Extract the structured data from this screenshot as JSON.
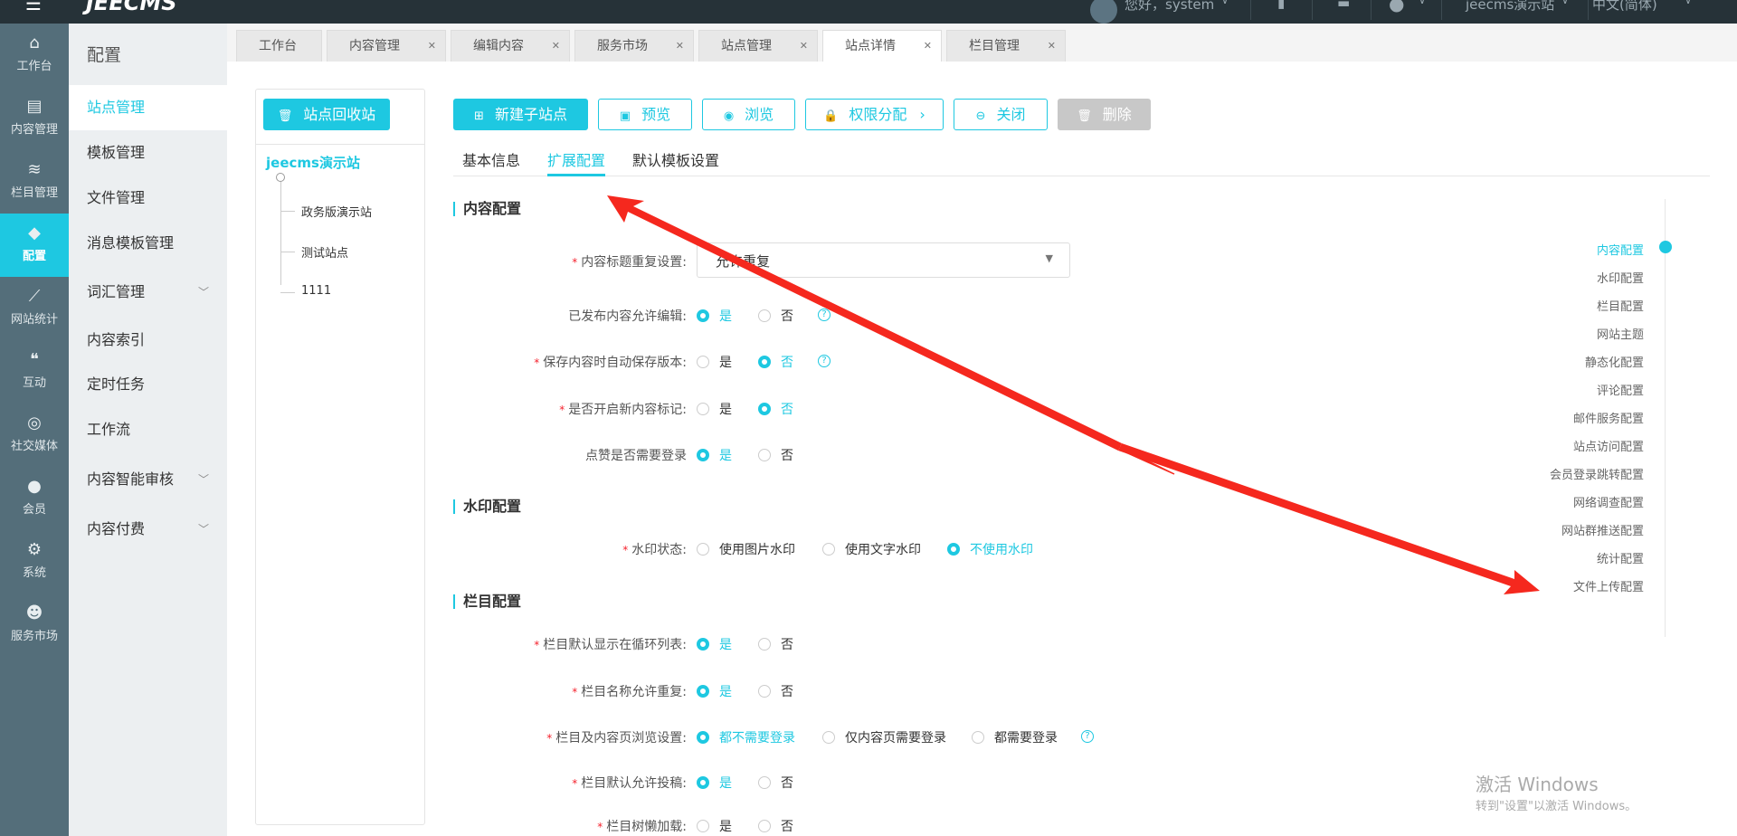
{
  "header": {
    "logo": "JEECMS",
    "greeting": "您好，system",
    "site": "jeecms演示站",
    "language": "中文(简体)"
  },
  "rail": [
    {
      "label": "工作台",
      "icon": "home-icon"
    },
    {
      "label": "内容管理",
      "icon": "document-edit-icon"
    },
    {
      "label": "栏目管理",
      "icon": "layers-icon"
    },
    {
      "label": "配置",
      "icon": "cube-icon",
      "active": true
    },
    {
      "label": "网站统计",
      "icon": "line-chart-icon"
    },
    {
      "label": "互动",
      "icon": "chat-icon"
    },
    {
      "label": "社交媒体",
      "icon": "target-icon"
    },
    {
      "label": "会员",
      "icon": "user-check-icon"
    },
    {
      "label": "系统",
      "icon": "gear-icon"
    },
    {
      "label": "服务市场",
      "icon": "headset-icon"
    }
  ],
  "submenu": {
    "title": "配置",
    "items": [
      {
        "label": "站点管理",
        "active": true
      },
      {
        "label": "模板管理"
      },
      {
        "label": "文件管理"
      },
      {
        "label": "消息模板管理"
      },
      {
        "label": "词汇管理",
        "expandable": true
      },
      {
        "label": "内容索引"
      },
      {
        "label": "定时任务"
      },
      {
        "label": "工作流"
      },
      {
        "label": "内容智能审核",
        "expandable": true
      },
      {
        "label": "内容付费",
        "expandable": true
      }
    ]
  },
  "tabs": [
    {
      "label": "工作台"
    },
    {
      "label": "内容管理",
      "closable": true
    },
    {
      "label": "编辑内容",
      "closable": true
    },
    {
      "label": "服务市场",
      "closable": true
    },
    {
      "label": "站点管理",
      "closable": true
    },
    {
      "label": "站点详情",
      "closable": true,
      "active": true
    },
    {
      "label": "栏目管理",
      "closable": true
    }
  ],
  "tree": {
    "recycle_button": "站点回收站",
    "root": "jeecms演示站",
    "children": [
      "政务版演示站",
      "测试站点",
      "1111"
    ]
  },
  "actions": [
    {
      "label": "新建子站点",
      "icon": "add-site-icon"
    },
    {
      "label": "预览",
      "icon": "preview-icon"
    },
    {
      "label": "浏览",
      "icon": "eye-icon"
    },
    {
      "label": "权限分配",
      "icon": "lock-icon"
    },
    {
      "label": "关闭",
      "icon": "minus-circle-icon"
    },
    {
      "label": "删除",
      "icon": "trash-icon"
    }
  ],
  "subtabs": [
    "基本信息",
    "扩展配置",
    "默认模板设置"
  ],
  "sections": {
    "content": "内容配置",
    "watermark": "水印配置",
    "column": "栏目配置"
  },
  "form": {
    "title_repeat": {
      "label": "内容标题重复设置:",
      "value": "允许重复"
    },
    "published_edit": {
      "label": "已发布内容允许编辑:",
      "options": [
        "是",
        "否"
      ],
      "selected": 0
    },
    "auto_save": {
      "label": "保存内容时自动保存版本:",
      "options": [
        "是",
        "否"
      ],
      "selected": 1
    },
    "new_mark": {
      "label": "是否开启新内容标记:",
      "options": [
        "是",
        "否"
      ],
      "selected": 1
    },
    "like_login": {
      "label": "点赞是否需要登录",
      "options": [
        "是",
        "否"
      ],
      "selected": 0
    },
    "watermark_status": {
      "label": "水印状态:",
      "options": [
        "使用图片水印",
        "使用文字水印",
        "不使用水印"
      ],
      "selected": 2
    },
    "column_loop": {
      "label": "栏目默认显示在循环列表:",
      "options": [
        "是",
        "否"
      ],
      "selected": 0
    },
    "column_name_repeat": {
      "label": "栏目名称允许重复:",
      "options": [
        "是",
        "否"
      ],
      "selected": 0
    },
    "column_browse": {
      "label": "栏目及内容页浏览设置:",
      "options": [
        "都不需要登录",
        "仅内容页需要登录",
        "都需要登录"
      ],
      "selected": 0
    },
    "column_contribute": {
      "label": "栏目默认允许投稿:",
      "options": [
        "是",
        "否"
      ],
      "selected": 0
    },
    "column_lazy": {
      "label": "栏目树懒加载:",
      "options": [
        "是",
        "否"
      ]
    }
  },
  "anchors": [
    "内容配置",
    "水印配置",
    "栏目配置",
    "网站主题",
    "静态化配置",
    "评论配置",
    "邮件服务配置",
    "站点访问配置",
    "会员登录跳转配置",
    "网络调查配置",
    "网站群推送配置",
    "统计配置",
    "文件上传配置"
  ],
  "watermark_os": {
    "line1": "激活 Windows",
    "line2": "转到\"设置\"以激活 Windows。"
  },
  "colors": {
    "accent": "#1ec8e1",
    "header": "#263238",
    "rail": "#546e7a",
    "annotation": "#f5281e"
  }
}
